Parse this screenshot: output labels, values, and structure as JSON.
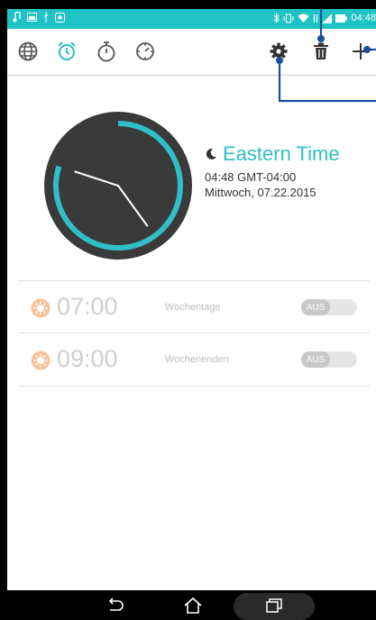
{
  "status_bar": {
    "time": "04:48",
    "background_color": "#1fc3c6",
    "left_icons": [
      "music-note-icon",
      "image-icon",
      "usb-icon",
      "photo-icon"
    ],
    "right_icons": [
      "bluetooth-icon",
      "vibrate-icon",
      "wifi-icon",
      "data-icon",
      "signal-icon",
      "battery-icon"
    ]
  },
  "toolbar": {
    "tabs": [
      {
        "icon": "globe-icon",
        "active": false
      },
      {
        "icon": "alarm-clock-icon",
        "active": true
      },
      {
        "icon": "stopwatch-icon",
        "active": false
      },
      {
        "icon": "timer-icon",
        "active": false
      }
    ],
    "actions": [
      "gear-icon",
      "trash-icon",
      "plus-icon"
    ],
    "accent_color": "#2fc0c7"
  },
  "world_clock": {
    "timezone_name": "Eastern Time",
    "time_line": "04:48  GMT-04:00",
    "date_line": "Mittwoch, 07.22.2015",
    "night_indicator": "moon-icon",
    "hour_hand_value": 4.8,
    "minute_hand_value": 48
  },
  "alarms": [
    {
      "time": "07:00",
      "days": "Wochentage",
      "toggle_label": "AUS",
      "enabled": false
    },
    {
      "time": "09:00",
      "days": "Wochenenden",
      "toggle_label": "AUS",
      "enabled": false
    }
  ],
  "nav_bar": {
    "buttons": [
      "back-icon",
      "home-icon",
      "recents-icon"
    ]
  }
}
